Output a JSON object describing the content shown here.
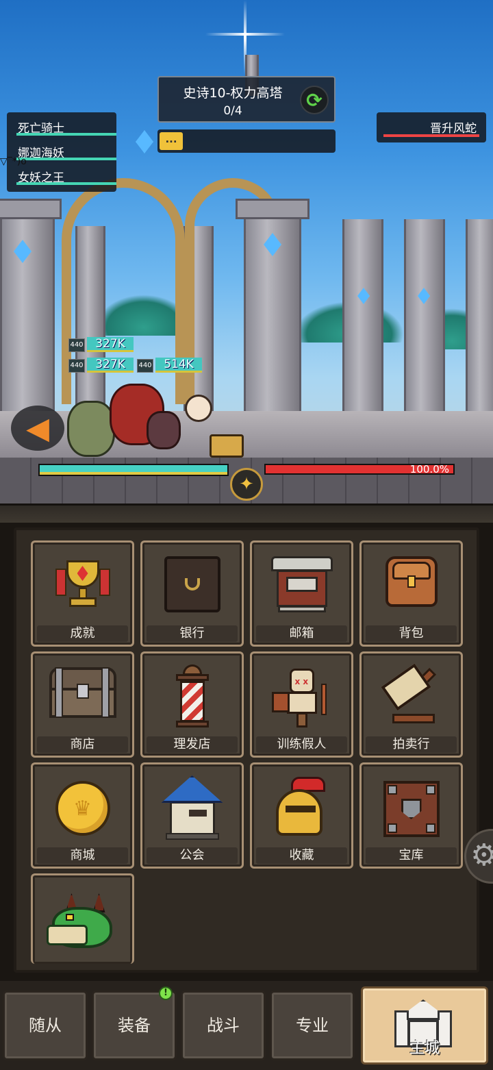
{
  "stage": {
    "title": "史诗10-权力高塔",
    "progress": "0/4",
    "refresh_icon": "refresh-icon",
    "chat_label": "..."
  },
  "team": {
    "members": [
      "死亡骑士",
      "娜迦海妖",
      "女妖之王"
    ],
    "emote": "▽‾*)o"
  },
  "enemy": {
    "name": "晋升风蛇"
  },
  "damage_popups": [
    {
      "level": "440",
      "value": "327K"
    },
    {
      "level": "440",
      "value": "327K"
    },
    {
      "level": "440",
      "value": "514K"
    }
  ],
  "battle": {
    "player_hp_fraction": 1.0,
    "enemy_hp_percent_text": "100.0%",
    "enemy_hp_fraction": 1.0
  },
  "menu": {
    "tiles": [
      {
        "label": "成就",
        "icon": "trophy-icon"
      },
      {
        "label": "银行",
        "icon": "safe-icon"
      },
      {
        "label": "邮箱",
        "icon": "mailbox-icon"
      },
      {
        "label": "背包",
        "icon": "backpack-icon"
      },
      {
        "label": "商店",
        "icon": "chest-icon"
      },
      {
        "label": "理发店",
        "icon": "barber-pole-icon"
      },
      {
        "label": "训练假人",
        "icon": "training-dummy-icon"
      },
      {
        "label": "拍卖行",
        "icon": "gavel-icon"
      },
      {
        "label": "商城",
        "icon": "crown-coin-icon"
      },
      {
        "label": "公会",
        "icon": "guild-house-icon"
      },
      {
        "label": "收藏",
        "icon": "helmet-icon"
      },
      {
        "label": "宝库",
        "icon": "vault-icon"
      },
      {
        "label": "",
        "icon": "dragon-icon"
      }
    ]
  },
  "nav": {
    "items": [
      "随从",
      "装备",
      "战斗",
      "专业",
      "主城"
    ],
    "active": "主城",
    "notification": "!"
  },
  "colors": {
    "ally_hp": "#46d1c4",
    "enemy_hp": "#e23232",
    "tile_border": "#a89074"
  }
}
